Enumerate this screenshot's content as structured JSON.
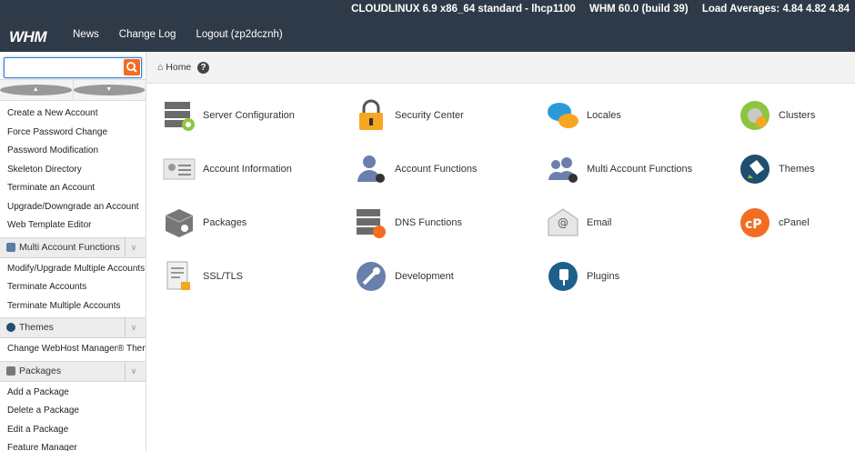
{
  "header": {
    "logo": "WHM",
    "system": "CLOUDLINUX 6.9 x86_64 standard - lhcp1100",
    "version": "WHM 60.0 (build 39)",
    "load": "Load Averages: 4.84 4.82 4.84",
    "nav": [
      "News",
      "Change Log",
      "Logout (zp2dcznh)"
    ]
  },
  "search": {
    "value": "",
    "placeholder": ""
  },
  "breadcrumb": {
    "home": "Home",
    "help": "?"
  },
  "sidebar": {
    "accounts": [
      "Create a New Account",
      "Force Password Change",
      "Password Modification",
      "Skeleton Directory",
      "Terminate an Account",
      "Upgrade/Downgrade an Account",
      "Web Template Editor"
    ],
    "multi_header": "Multi Account Functions",
    "multi": [
      "Modify/Upgrade Multiple Accounts",
      "Terminate Accounts",
      "Terminate Multiple Accounts"
    ],
    "themes_header": "Themes",
    "themes": [
      "Change WebHost Manager® Theme"
    ],
    "packages_header": "Packages",
    "packages": [
      "Add a Package",
      "Delete a Package",
      "Edit a Package",
      "Feature Manager"
    ]
  },
  "tiles": [
    {
      "label": "Server Configuration",
      "icon": "server-gear-icon"
    },
    {
      "label": "Security Center",
      "icon": "padlock-icon"
    },
    {
      "label": "Locales",
      "icon": "locales-bubble-icon"
    },
    {
      "label": "Clusters",
      "icon": "clusters-icon"
    },
    {
      "label": "Account Information",
      "icon": "id-card-icon"
    },
    {
      "label": "Account Functions",
      "icon": "user-gear-icon"
    },
    {
      "label": "Multi Account Functions",
      "icon": "users-gear-icon"
    },
    {
      "label": "Themes",
      "icon": "paint-bucket-icon"
    },
    {
      "label": "Packages",
      "icon": "box-gear-icon"
    },
    {
      "label": "DNS Functions",
      "icon": "dns-server-icon"
    },
    {
      "label": "Email",
      "icon": "envelope-icon"
    },
    {
      "label": "cPanel",
      "icon": "cpanel-icon"
    },
    {
      "label": "SSL/TLS",
      "icon": "certificate-lock-icon"
    },
    {
      "label": "Development",
      "icon": "wrench-icon"
    },
    {
      "label": "Plugins",
      "icon": "plug-icon"
    }
  ]
}
